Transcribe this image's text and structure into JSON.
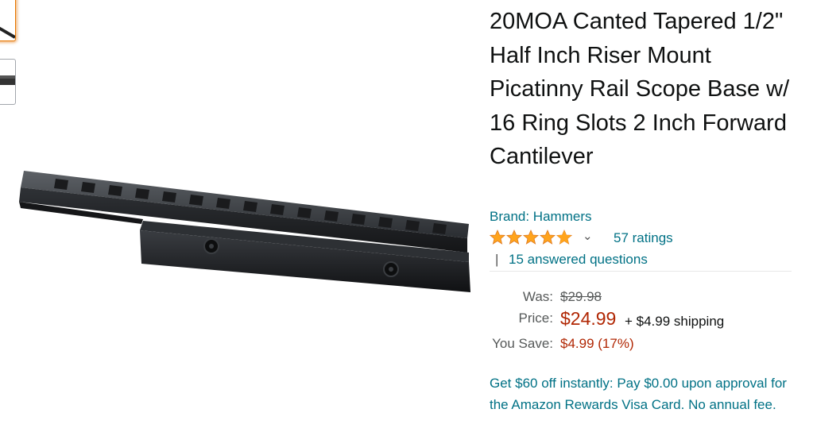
{
  "product": {
    "title": "20MOA Canted Tapered 1/2\" Half Inch Riser Mount Picatinny Rail Scope Base w/ 16 Ring Slots 2 Inch Forward Cantilever",
    "brand": "Brand: Hammers",
    "image_alt": "Picatinny rail riser mount"
  },
  "rating": {
    "stars": 4.5,
    "ratings_count_text": "57 ratings",
    "separator": "|",
    "answered_questions_text": "15 answered questions",
    "dropdown_icon": "chevron-down-icon"
  },
  "pricing": {
    "was_label": "Was:",
    "was_value": "$29.98",
    "price_label": "Price:",
    "price_value": "$24.99",
    "shipping_text": "+ $4.99 shipping",
    "save_label": "You Save:",
    "save_value": "$4.99 (17%)"
  },
  "promo": {
    "text": "Get $60 off instantly: Pay $0.00 upon approval for the Amazon Rewards Visa Card. No annual fee."
  },
  "thumbnails": [
    {
      "name": "thumbnail-1",
      "active": true
    },
    {
      "name": "thumbnail-2",
      "active": false
    }
  ],
  "colors": {
    "link": "#007185",
    "price": "#b12704",
    "star": "#ffa41c",
    "muted": "#565959",
    "active_thumb_border": "#e77600"
  }
}
